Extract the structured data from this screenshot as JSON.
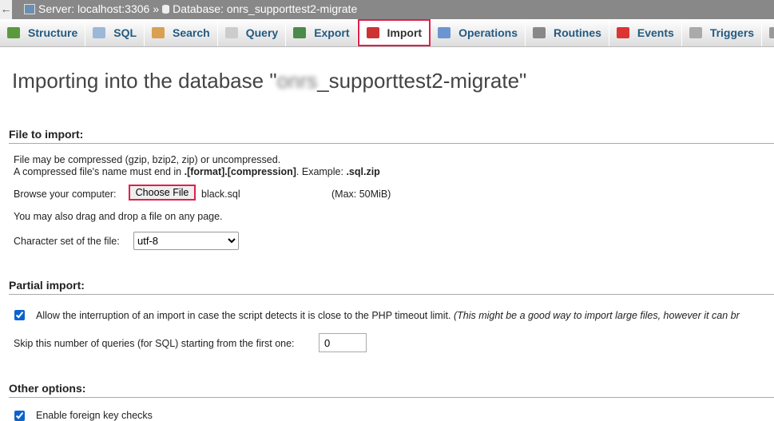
{
  "breadcrumb": {
    "server": "Server: localhost:3306",
    "sep": "»",
    "database": "Database: onrs_supporttest2-migrate"
  },
  "tabs": [
    {
      "label": "Structure",
      "icon": "structure-icon",
      "color": "#5a9a3c"
    },
    {
      "label": "SQL",
      "icon": "sql-icon",
      "color": "#9cb8d8"
    },
    {
      "label": "Search",
      "icon": "search-icon",
      "color": "#d8a050"
    },
    {
      "label": "Query",
      "icon": "query-icon",
      "color": "#ccc"
    },
    {
      "label": "Export",
      "icon": "export-icon",
      "color": "#4a8a4a"
    },
    {
      "label": "Import",
      "icon": "import-icon",
      "color": "#c33",
      "active": true
    },
    {
      "label": "Operations",
      "icon": "wrench-icon",
      "color": "#6b95d0"
    },
    {
      "label": "Routines",
      "icon": "gears-icon",
      "color": "#888"
    },
    {
      "label": "Events",
      "icon": "clock-icon",
      "color": "#d33"
    },
    {
      "label": "Triggers",
      "icon": "triggers-icon",
      "color": "#aaa"
    }
  ],
  "title": {
    "prefix": "Importing into the database \"",
    "blurred": "onrs",
    "suffix": "_supporttest2-migrate\""
  },
  "file_import": {
    "heading": "File to import:",
    "line1": "File may be compressed (gzip, bzip2, zip) or uncompressed.",
    "line2a": "A compressed file's name must end in ",
    "line2b": ".[format].[compression]",
    "line2c": ". Example: ",
    "line2d": ".sql.zip",
    "browse_label": "Browse your computer:",
    "choose_button": "Choose File",
    "file_name": "black.sql",
    "max": "(Max: 50MiB)",
    "drag": "You may also drag and drop a file on any page.",
    "charset_label": "Character set of the file:",
    "charset_value": "utf-8"
  },
  "partial": {
    "heading": "Partial import:",
    "allow_label": "Allow the interruption of an import in case the script detects it is close to the PHP timeout limit.",
    "allow_note": "(This might be a good way to import large files, however it can br",
    "allow_checked": true,
    "skip_label": "Skip this number of queries (for SQL) starting from the first one:",
    "skip_value": "0"
  },
  "other": {
    "heading": "Other options:",
    "fk_label": "Enable foreign key checks",
    "fk_checked": true
  }
}
